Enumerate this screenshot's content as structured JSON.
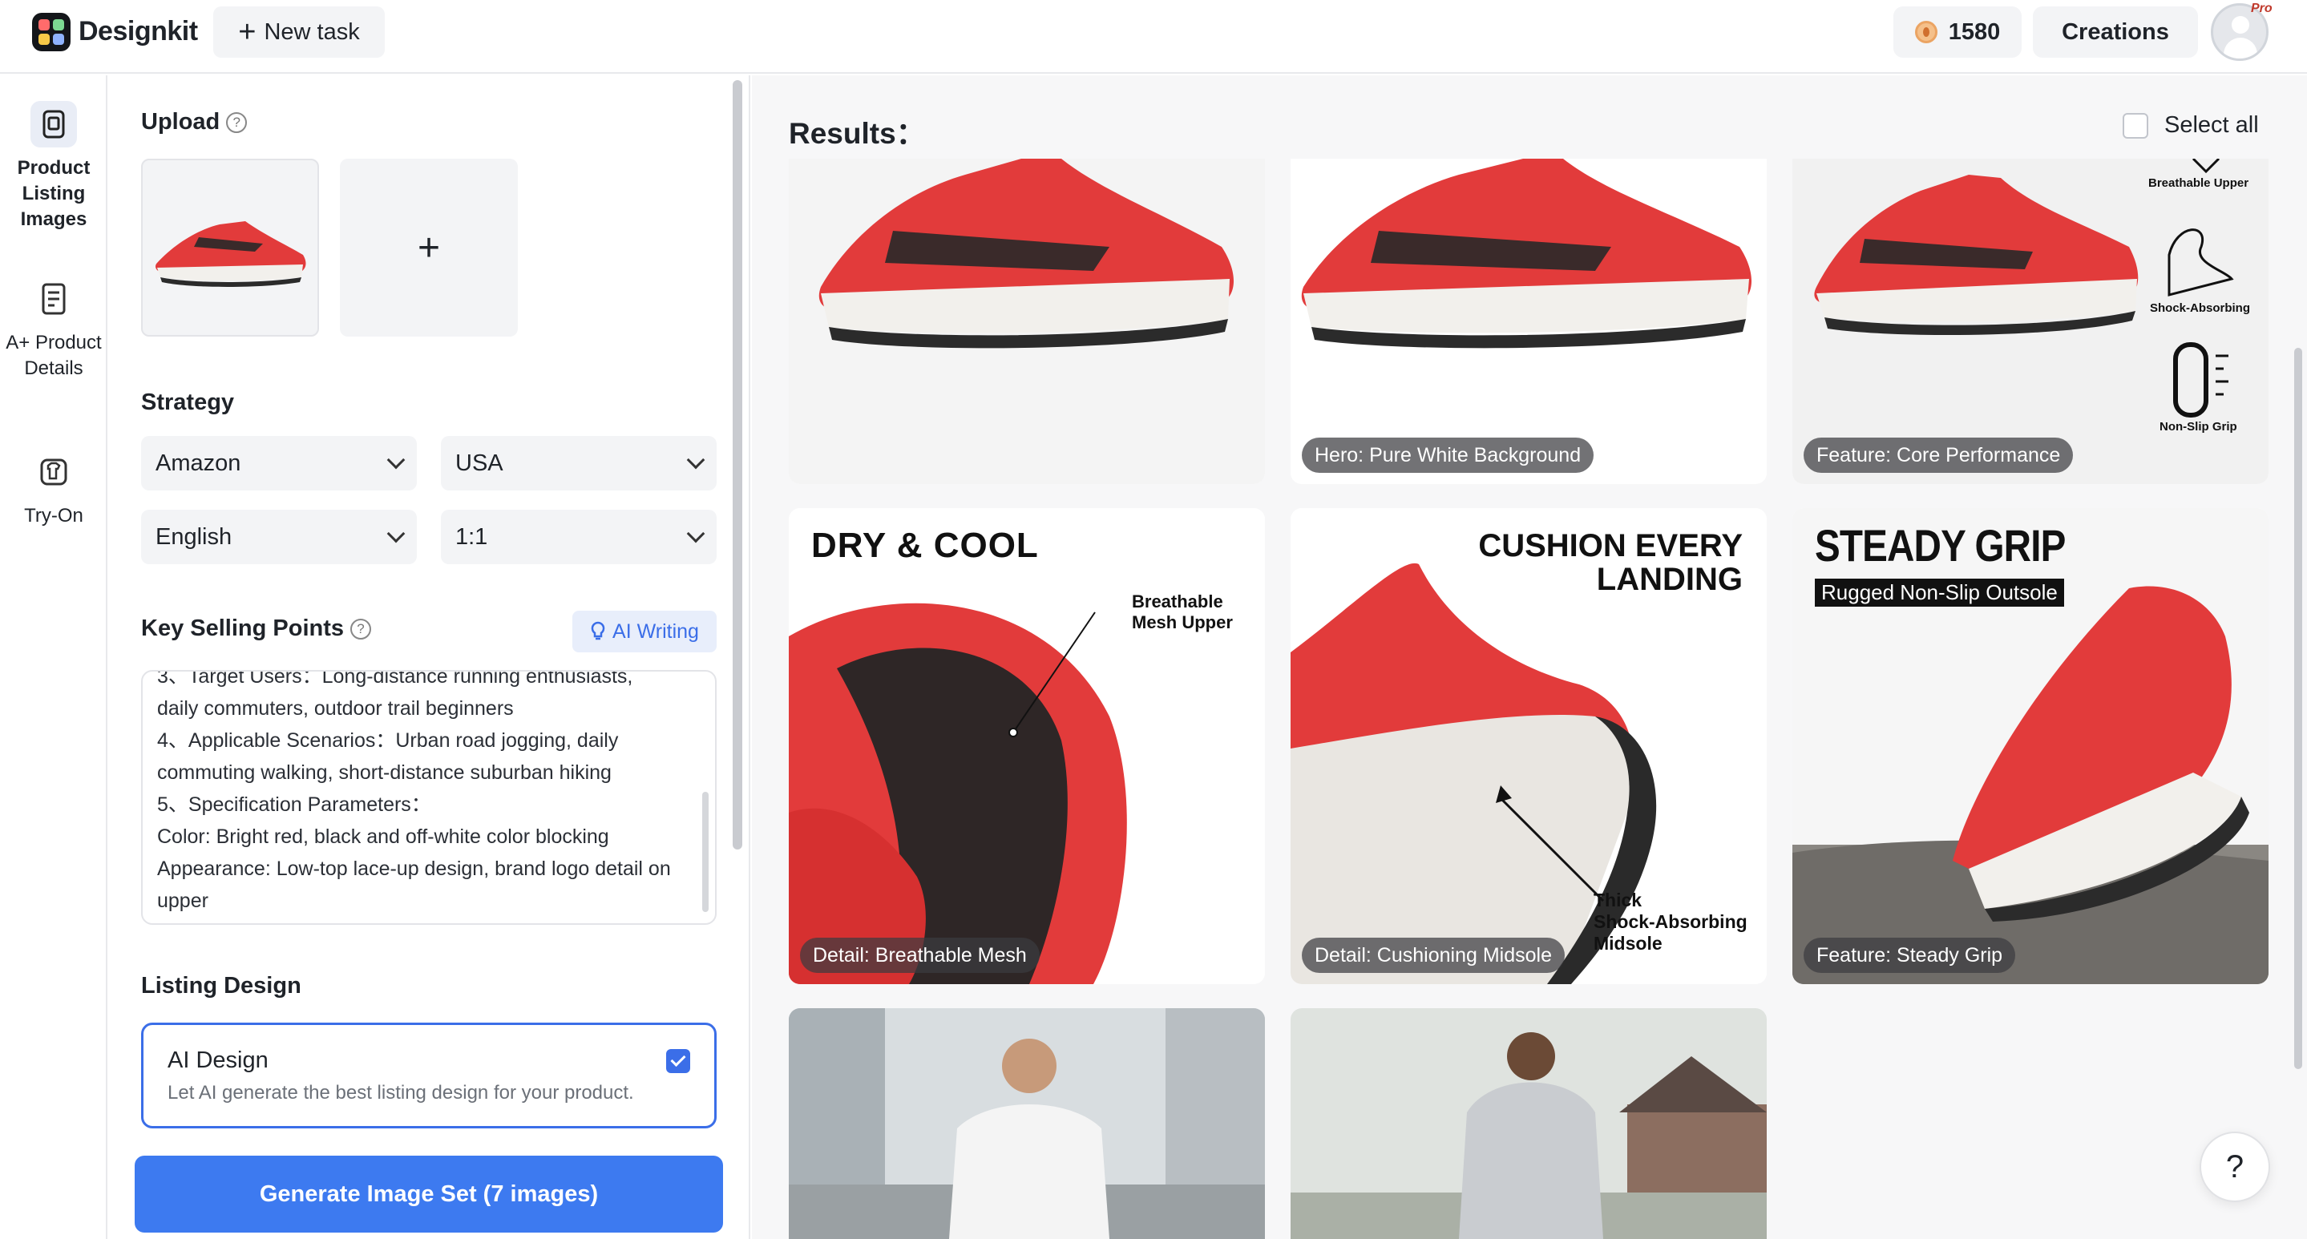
{
  "header": {
    "brand": "Designkit",
    "new_task_label": "New task",
    "credits": "1580",
    "creations_label": "Creations",
    "pro_badge": "Pro"
  },
  "rail": {
    "items": [
      {
        "label": "Product Listing Images",
        "icon": "product-listing-icon",
        "active": true
      },
      {
        "label": "A+ Product Details",
        "icon": "a-plus-details-icon",
        "active": false
      },
      {
        "label": "Try-On",
        "icon": "try-on-icon",
        "active": false
      }
    ]
  },
  "panel": {
    "upload_label": "Upload",
    "strategy_label": "Strategy",
    "platform": "Amazon",
    "region": "USA",
    "language": "English",
    "ratio": "1:1",
    "ksp_label": "Key Selling Points",
    "ai_writing_label": "AI Writing",
    "ksp_lines": [
      "3、Target Users：Long-distance running enthusiasts,",
      "daily commuters, outdoor trail beginners",
      "4、Applicable Scenarios：Urban road jogging, daily",
      "commuting walking, short-distance suburban hiking",
      "5、Specification Parameters：",
      "Color: Bright red, black and off-white color blocking",
      "Appearance: Low-top lace-up design, brand logo detail on",
      "upper"
    ],
    "listing_design_label": "Listing Design",
    "ai_design_title": "AI Design",
    "ai_design_desc": "Let AI generate the best listing design for your product.",
    "generate_label": "Generate Image Set (7 images)"
  },
  "results": {
    "title": "Results：",
    "select_all_label": "Select all",
    "cards": [
      {
        "tag": ""
      },
      {
        "tag": "Hero: Pure White Background"
      },
      {
        "tag": "Feature: Core Performance",
        "features": [
          "Breathable Upper",
          "Shock-Absorbing",
          "Non-Slip Grip"
        ]
      },
      {
        "tag": "Detail: Breathable Mesh",
        "headline": "DRY & COOL",
        "callout": "Breathable Mesh Upper"
      },
      {
        "tag": "Detail: Cushioning Midsole",
        "headline1": "CUSHION EVERY",
        "headline2": "LANDING",
        "callout1": "Thick",
        "callout2": "Shock-Absorbing",
        "callout3": "Midsole"
      },
      {
        "tag": "Feature: Steady Grip",
        "headline": "STEADY GRIP",
        "sub": "Rugged Non-Slip Outsole"
      },
      {
        "tag": ""
      },
      {
        "tag": ""
      }
    ]
  },
  "help_label": "?",
  "colors": {
    "accent": "#3d7af0",
    "shoe_red": "#e23b3b"
  }
}
